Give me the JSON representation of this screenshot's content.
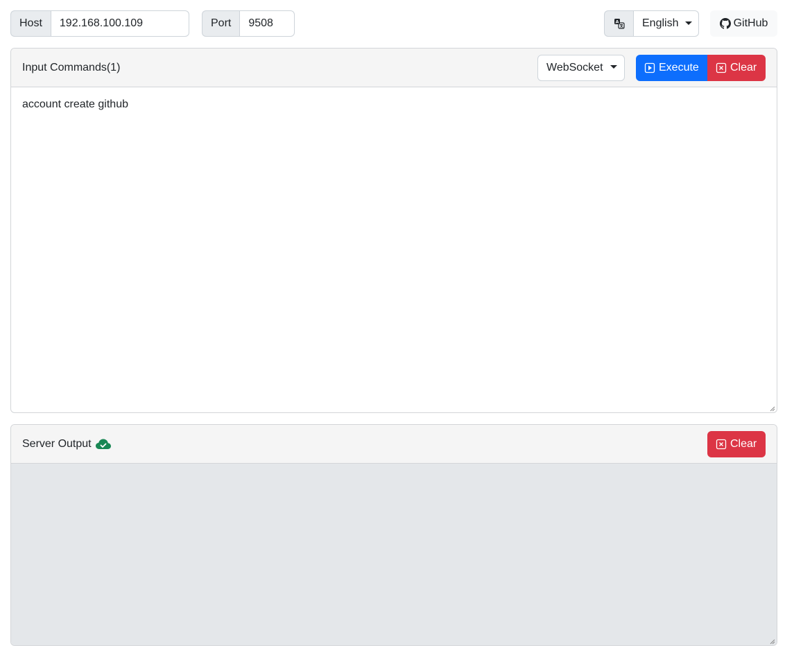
{
  "connection": {
    "host_label": "Host",
    "host_value": "192.168.100.109",
    "port_label": "Port",
    "port_value": "9508"
  },
  "language": {
    "icon": "translate-icon",
    "selected": "English"
  },
  "github": {
    "icon": "github-icon",
    "label": "GitHub"
  },
  "input_panel": {
    "title": "Input Commands(1)",
    "protocol_selected": "WebSocket",
    "execute_label": "Execute",
    "clear_label": "Clear",
    "commands": "account create github"
  },
  "output_panel": {
    "title": "Server Output",
    "status_icon": "cloud-check-icon",
    "status_color": "#198754",
    "clear_label": "Clear",
    "content": ""
  },
  "colors": {
    "primary": "#0d6efd",
    "danger": "#dc3545",
    "success": "#198754"
  }
}
